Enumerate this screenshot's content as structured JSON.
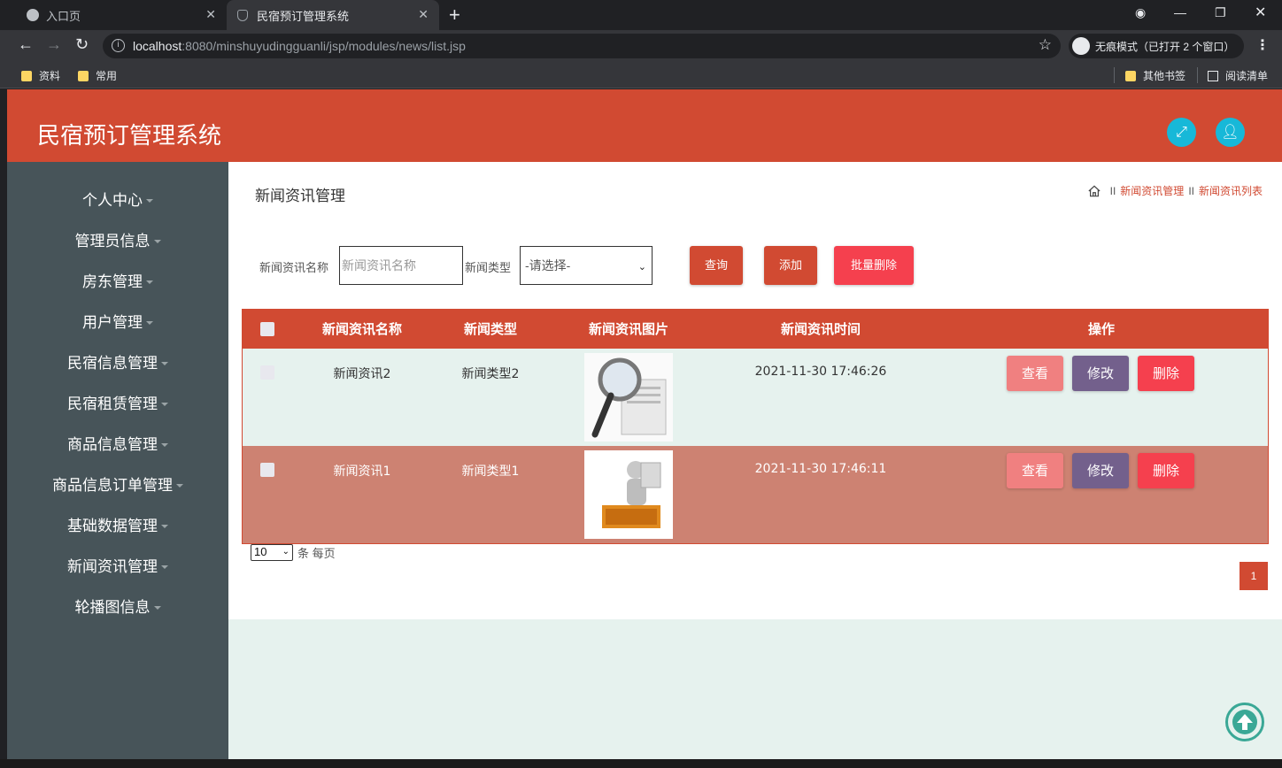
{
  "browser": {
    "tabs": [
      {
        "label": "入口页",
        "active": false
      },
      {
        "label": "民宿预订管理系统",
        "active": true
      }
    ],
    "url_host": "localhost",
    "url_path": ":8080/minshuyudingguanli/jsp/modules/news/list.jsp",
    "incognito_label": "无痕模式（已打开 2 个窗口）",
    "bookmarks": [
      "资料",
      "常用"
    ],
    "other_bookmarks": "其他书签",
    "reading_list": "阅读清单"
  },
  "app": {
    "title": "民宿预订管理系统",
    "accent": "#d14a32",
    "sidebar_bg": "#475459"
  },
  "sidebar": {
    "items": [
      {
        "label": "个人中心"
      },
      {
        "label": "管理员信息"
      },
      {
        "label": "房东管理"
      },
      {
        "label": "用户管理"
      },
      {
        "label": "民宿信息管理"
      },
      {
        "label": "民宿租赁管理"
      },
      {
        "label": "商品信息管理"
      },
      {
        "label": "商品信息订单管理"
      },
      {
        "label": "基础数据管理"
      },
      {
        "label": "新闻资讯管理"
      },
      {
        "label": "轮播图信息"
      }
    ]
  },
  "page": {
    "title": "新闻资讯管理",
    "breadcrumb": [
      "新闻资讯管理",
      "新闻资讯列表"
    ],
    "breadcrumb_sep": "II"
  },
  "search": {
    "name_label": "新闻资讯名称",
    "name_placeholder": "新闻资讯名称",
    "type_label": "新闻类型",
    "type_selected": "-请选择-",
    "query_button": "查询",
    "add_button": "添加",
    "batch_delete_button": "批量删除"
  },
  "table": {
    "headers": [
      "新闻资讯名称",
      "新闻类型",
      "新闻资讯图片",
      "新闻资讯时间",
      "操作"
    ],
    "rows": [
      {
        "name": "新闻资讯2",
        "type": "新闻类型2",
        "time": "2021-11-30 17:46:26",
        "image": "news-magnifier-image"
      },
      {
        "name": "新闻资讯1",
        "type": "新闻类型1",
        "time": "2021-11-30 17:46:11",
        "image": "news-figure-image"
      }
    ],
    "actions": {
      "view": "查看",
      "edit": "修改",
      "delete": "删除"
    }
  },
  "pagination": {
    "page_size": "10",
    "page_size_suffix": "条 每页",
    "current_page": "1"
  }
}
